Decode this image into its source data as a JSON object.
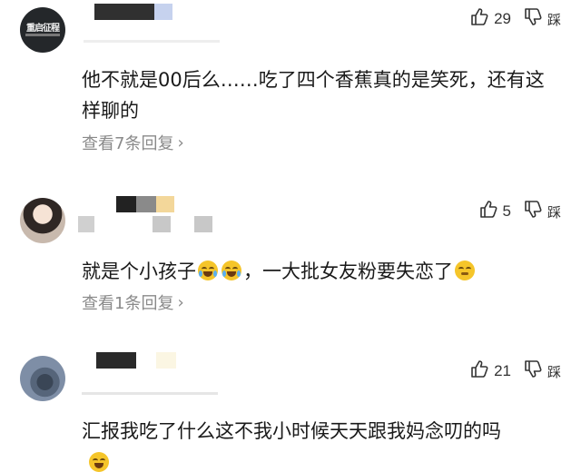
{
  "comments": [
    {
      "avatar_text": "重启征程",
      "likes": "29",
      "dislike_label": "踩",
      "text": "他不就是00后么……吃了四个香蕉真的是笑死，还有这样聊的",
      "reply_label": "查看7条回复"
    },
    {
      "likes": "5",
      "dislike_label": "踩",
      "text_before": "就是个小孩子",
      "text_after": "，一大批女友粉要失恋了",
      "reply_label": "查看1条回复"
    },
    {
      "likes": "21",
      "dislike_label": "踩",
      "text": "汇报我吃了什么这不我小时候天天跟我妈念叨的吗"
    }
  ],
  "icons": {
    "like": "thumbs-up-icon",
    "dislike": "thumbs-down-icon",
    "chevron": "chevron-right-icon"
  },
  "colors": {
    "text": "#1a1a1a",
    "muted": "#8a8a8a",
    "emoji": "#f5c52a"
  }
}
